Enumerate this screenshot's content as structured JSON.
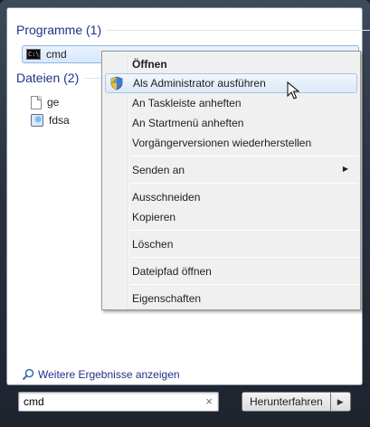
{
  "programs": {
    "header": "Programme (1)",
    "items": [
      {
        "label": "cmd",
        "icon": "console-icon"
      }
    ]
  },
  "files": {
    "header": "Dateien (2)",
    "items": [
      {
        "label": "ge",
        "icon": "document-icon"
      },
      {
        "label": "fdsa",
        "icon": "image-file-icon"
      }
    ]
  },
  "more_results": "Weitere Ergebnisse anzeigen",
  "search": {
    "value": "cmd",
    "clear": "×"
  },
  "shutdown": {
    "label": "Herunterfahren",
    "arrow": "▶"
  },
  "context_menu": {
    "items": [
      {
        "label": "Öffnen"
      },
      {
        "label": "Als Administrator ausführen"
      },
      {
        "label": "An Taskleiste anheften"
      },
      {
        "label": "An Startmenü anheften"
      },
      {
        "label": "Vorgängerversionen wiederherstellen"
      },
      {
        "label": "Senden an",
        "arrow": "▶"
      },
      {
        "label": "Ausschneiden"
      },
      {
        "label": "Kopieren"
      },
      {
        "label": "Löschen"
      },
      {
        "label": "Dateipfad öffnen"
      },
      {
        "label": "Eigenschaften"
      }
    ]
  },
  "colors": {
    "header_blue": "#1e3287",
    "selection_border": "#8db6e6",
    "menu_background": "#f0f0f0"
  }
}
